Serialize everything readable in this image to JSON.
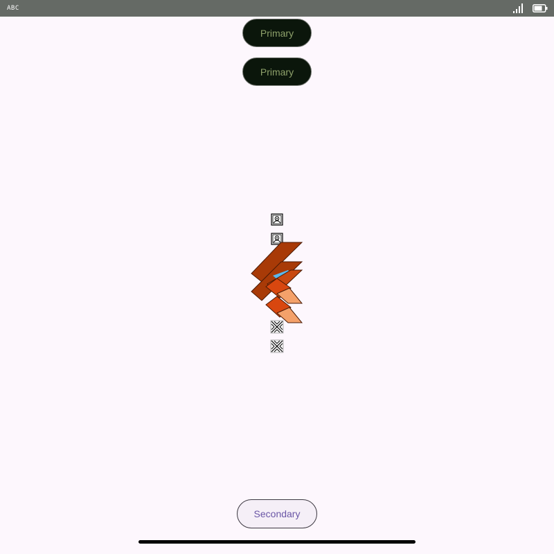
{
  "status_bar": {
    "carrier": "ABC",
    "background": "#656a65",
    "signal_icon": "signal-icon",
    "battery_icon": "battery-icon"
  },
  "buttons": {
    "primary_1_label": "Primary",
    "primary_2_label": "Primary",
    "secondary_label": "Secondary"
  },
  "icons": {
    "placeholder": "image-placeholder-icon",
    "logo": "flutter-logo",
    "broken": "broken-image-icon"
  },
  "colors": {
    "page_background": "#fdf7fd",
    "primary_button_bg": "#0b160b",
    "primary_button_text": "#8ea16a",
    "secondary_button_bg": "#f5eff7",
    "secondary_button_text": "#6a56a6"
  }
}
